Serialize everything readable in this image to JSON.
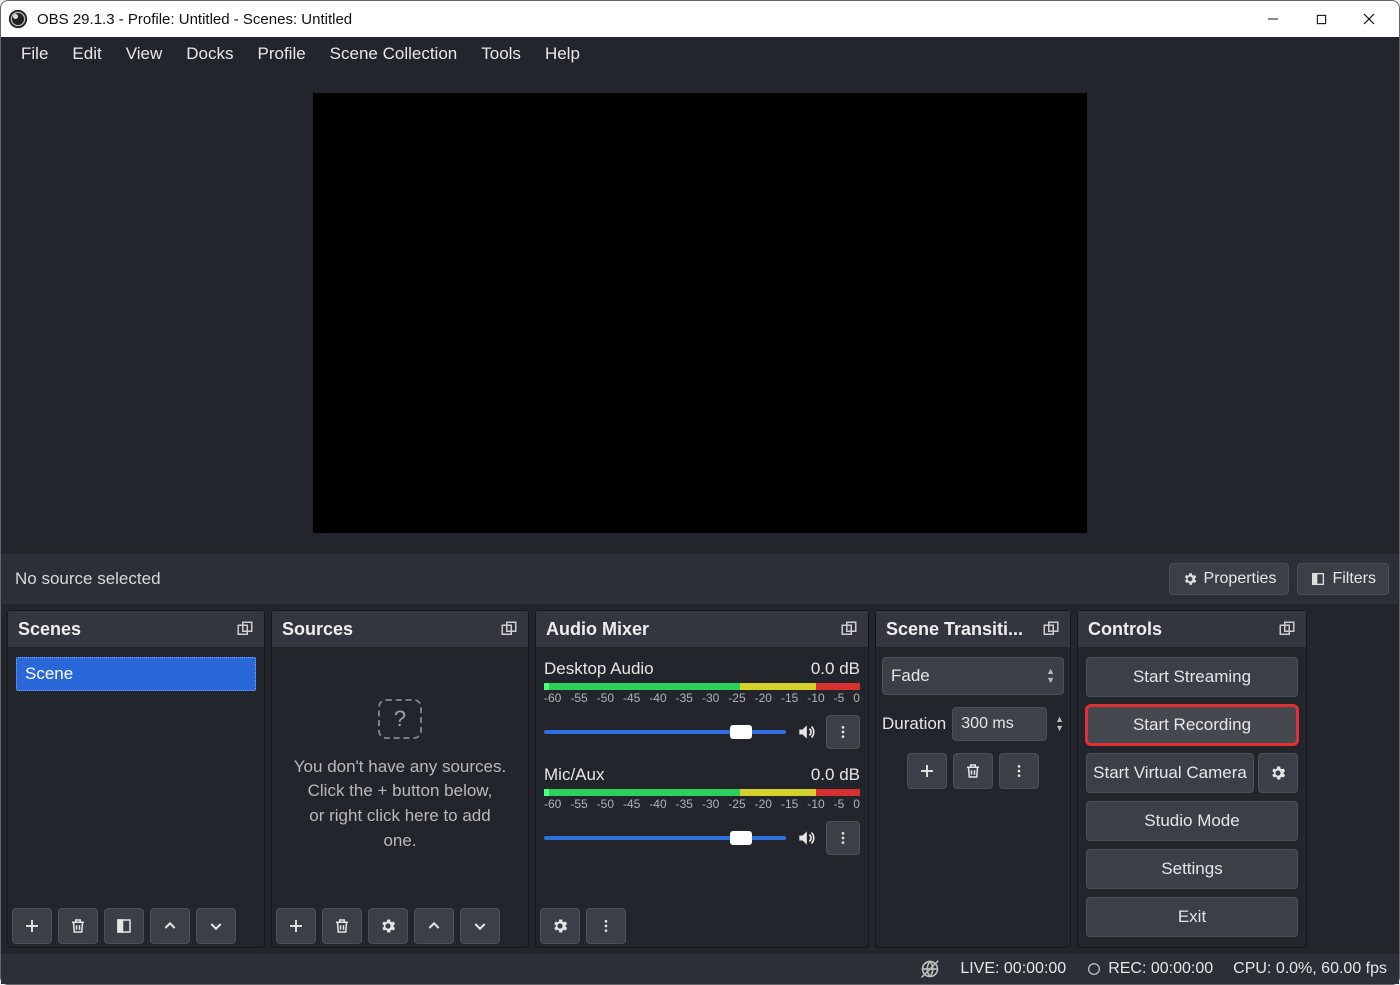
{
  "titlebar": {
    "title": "OBS 29.1.3 - Profile: Untitled - Scenes: Untitled"
  },
  "menubar": {
    "items": [
      "File",
      "Edit",
      "View",
      "Docks",
      "Profile",
      "Scene Collection",
      "Tools",
      "Help"
    ]
  },
  "sourcebar": {
    "no_source": "No source selected",
    "properties": "Properties",
    "filters": "Filters"
  },
  "panels": {
    "scenes": {
      "title": "Scenes",
      "items": [
        "Scene"
      ]
    },
    "sources": {
      "title": "Sources",
      "empty_line1": "You don't have any sources.",
      "empty_line2": "Click the + button below,",
      "empty_line3": "or right click here to add one."
    },
    "mixer": {
      "title": "Audio Mixer",
      "channels": [
        {
          "name": "Desktop Audio",
          "db": "0.0 dB"
        },
        {
          "name": "Mic/Aux",
          "db": "0.0 dB"
        }
      ],
      "ticks": [
        "-60",
        "-55",
        "-50",
        "-45",
        "-40",
        "-35",
        "-30",
        "-25",
        "-20",
        "-15",
        "-10",
        "-5",
        "0"
      ]
    },
    "transitions": {
      "title": "Scene Transiti...",
      "selected": "Fade",
      "duration_label": "Duration",
      "duration_value": "300 ms"
    },
    "controls": {
      "title": "Controls",
      "start_streaming": "Start Streaming",
      "start_recording": "Start Recording",
      "start_virtual_camera": "Start Virtual Camera",
      "studio_mode": "Studio Mode",
      "settings": "Settings",
      "exit": "Exit"
    }
  },
  "statusbar": {
    "live": "LIVE: 00:00:00",
    "rec": "REC: 00:00:00",
    "cpu": "CPU: 0.0%, 60.00 fps"
  }
}
